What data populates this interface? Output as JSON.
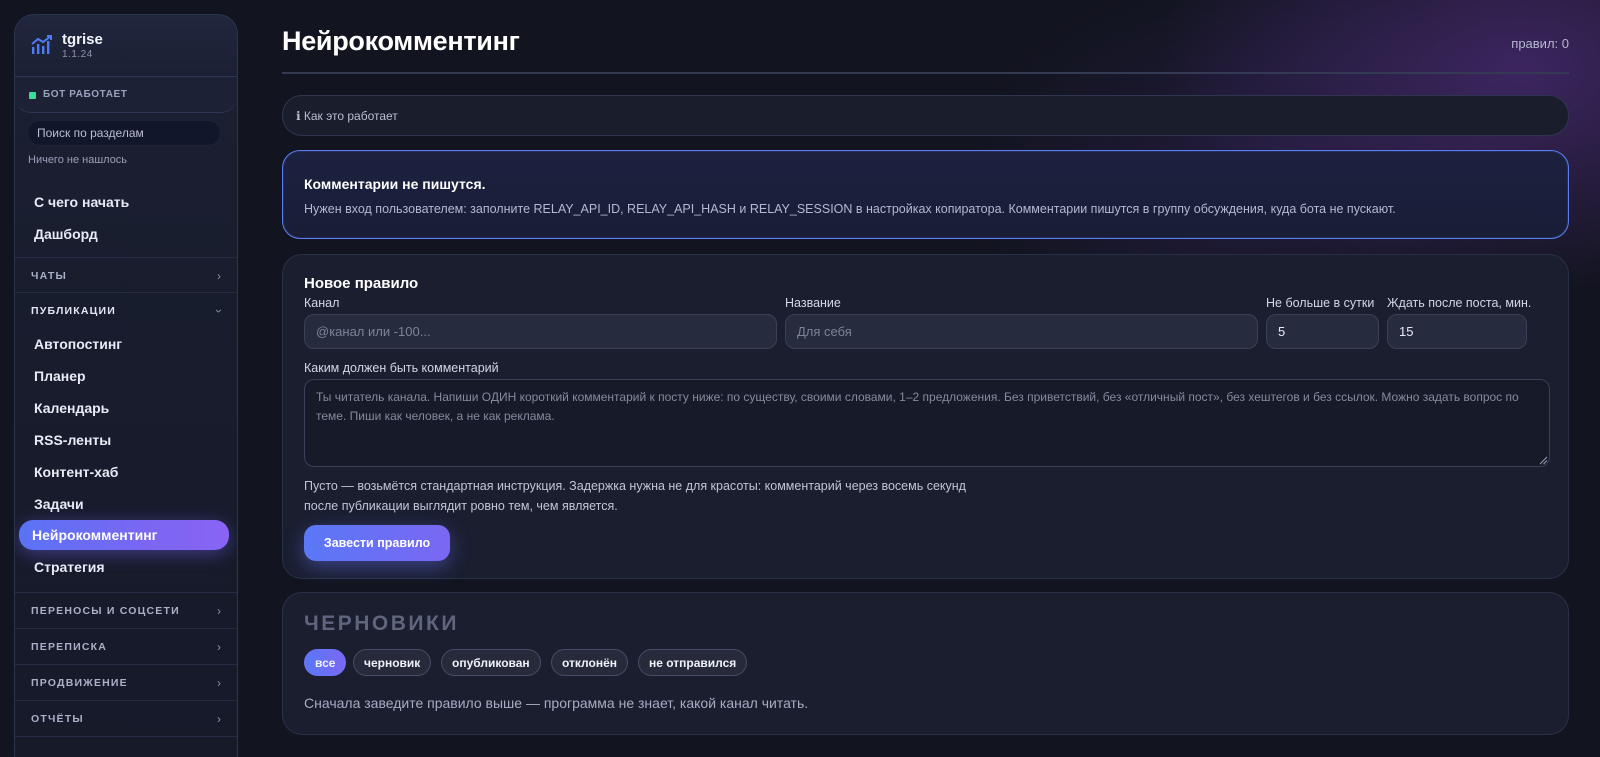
{
  "sidebar": {
    "brand": {
      "name": "tgrise",
      "version": "1.1.24"
    },
    "status": "БОТ РАБОТАЕТ",
    "search": {
      "placeholder": "Поиск по разделам",
      "value": ""
    },
    "nothing_found": "Ничего не нашлось",
    "top_items": [
      "С чего начать",
      "Дашборд"
    ],
    "sections": {
      "chats": "ЧАТЫ",
      "publications": "ПУБЛИКАЦИИ",
      "transfers": "ПЕРЕНОСЫ И СОЦСЕТИ",
      "messaging": "ПЕРЕПИСКА",
      "promotion": "ПРОДВИЖЕНИЕ",
      "reports": "ОТЧЁТЫ"
    },
    "publication_items": [
      "Автопостинг",
      "Планер",
      "Календарь",
      "RSS-ленты",
      "Контент-хаб",
      "Задачи",
      "Нейрокомментинг",
      "Стратегия"
    ],
    "active_item": "Нейрокомментинг"
  },
  "header": {
    "title": "Нейрокомментинг",
    "rules_count": "правил: 0"
  },
  "how_it_works": "ℹ Как это работает",
  "alert": {
    "title": "Комментарии не пишутся.",
    "body": "Нужен вход пользователем: заполните RELAY_API_ID, RELAY_API_HASH и RELAY_SESSION в настройках копиратора. Комментарии пишутся в группу обсуждения, куда бота не пускают."
  },
  "new_rule": {
    "title": "Новое правило",
    "channel": {
      "label": "Канал",
      "placeholder": "@канал или -100...",
      "value": ""
    },
    "name": {
      "label": "Название",
      "placeholder": "Для себя",
      "value": ""
    },
    "max_per_day": {
      "label": "Не больше в сутки",
      "value": "5"
    },
    "wait_after_post": {
      "label": "Ждать после поста, мин.",
      "value": "15"
    },
    "comment": {
      "label": "Каким должен быть комментарий",
      "placeholder": "Ты читатель канала. Напиши ОДИН короткий комментарий к посту ниже: по существу, своими словами, 1–2 предложения. Без приветствий, без «отличный пост», без хештегов и без ссылок. Можно задать вопрос по теме. Пиши как человек, а не как реклама.",
      "value": ""
    },
    "hint_line1": "Пусто — возьмётся стандартная инструкция. Задержка нужна не для красоты: комментарий через восемь секунд",
    "hint_line2": "после публикации выглядит ровно тем, чем является.",
    "submit_label": "Завести правило"
  },
  "drafts": {
    "title": "ЧЕРНОВИКИ",
    "filters": [
      "все",
      "черновик",
      "опубликован",
      "отклонён",
      "не отправился"
    ],
    "active_filter": "все",
    "empty_message": "Сначала заведите правило выше — программа не знает, какой канал читать."
  },
  "colors": {
    "accent": "#6a6ff4",
    "status_ok": "#3ddc97",
    "alert_border": "#5a7ef0",
    "background": "#12141f"
  }
}
